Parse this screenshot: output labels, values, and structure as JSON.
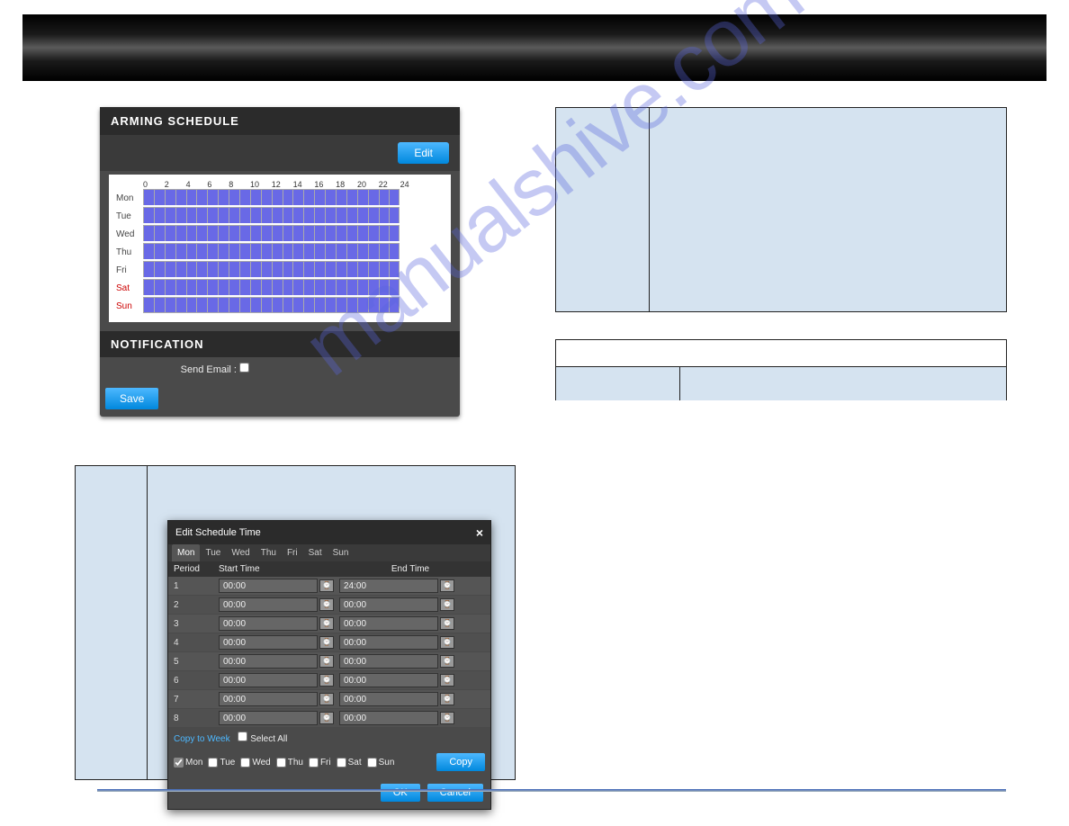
{
  "watermark": "manualshive.com",
  "arming": {
    "title": "ARMING SCHEDULE",
    "edit_label": "Edit",
    "hours": [
      "0",
      "2",
      "4",
      "6",
      "8",
      "10",
      "12",
      "14",
      "16",
      "18",
      "20",
      "22",
      "24"
    ],
    "days": [
      {
        "label": "Mon",
        "weekend": false
      },
      {
        "label": "Tue",
        "weekend": false
      },
      {
        "label": "Wed",
        "weekend": false
      },
      {
        "label": "Thu",
        "weekend": false
      },
      {
        "label": "Fri",
        "weekend": false
      },
      {
        "label": "Sat",
        "weekend": true
      },
      {
        "label": "Sun",
        "weekend": true
      }
    ]
  },
  "notification": {
    "title": "NOTIFICATION",
    "send_email_label": "Send Email :",
    "send_email_checked": false
  },
  "save_label": "Save",
  "dialog": {
    "title": "Edit Schedule Time",
    "tabs": [
      "Mon",
      "Tue",
      "Wed",
      "Thu",
      "Fri",
      "Sat",
      "Sun"
    ],
    "active_tab": 0,
    "headers": {
      "period": "Period",
      "start": "Start Time",
      "end": "End Time"
    },
    "periods": [
      {
        "n": "1",
        "start": "00:00",
        "end": "24:00"
      },
      {
        "n": "2",
        "start": "00:00",
        "end": "00:00"
      },
      {
        "n": "3",
        "start": "00:00",
        "end": "00:00"
      },
      {
        "n": "4",
        "start": "00:00",
        "end": "00:00"
      },
      {
        "n": "5",
        "start": "00:00",
        "end": "00:00"
      },
      {
        "n": "6",
        "start": "00:00",
        "end": "00:00"
      },
      {
        "n": "7",
        "start": "00:00",
        "end": "00:00"
      },
      {
        "n": "8",
        "start": "00:00",
        "end": "00:00"
      }
    ],
    "copy_to_week": "Copy to Week",
    "select_all": "Select All",
    "select_all_checked": false,
    "day_checks": [
      {
        "label": "Mon",
        "checked": true
      },
      {
        "label": "Tue",
        "checked": false
      },
      {
        "label": "Wed",
        "checked": false
      },
      {
        "label": "Thu",
        "checked": false
      },
      {
        "label": "Fri",
        "checked": false
      },
      {
        "label": "Sat",
        "checked": false
      },
      {
        "label": "Sun",
        "checked": false
      }
    ],
    "copy_label": "Copy",
    "ok_label": "OK",
    "cancel_label": "Cancel"
  }
}
